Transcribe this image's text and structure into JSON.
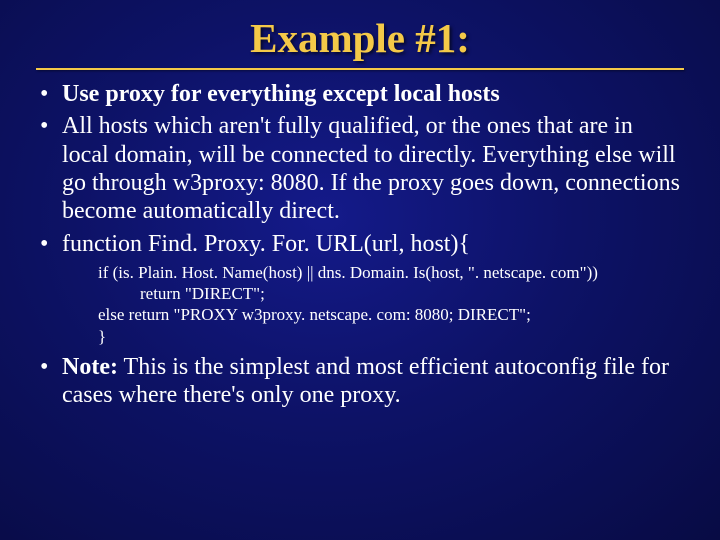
{
  "title": "Example #1:",
  "bullets": {
    "b1": "Use proxy for everything except local hosts",
    "b2": "All hosts which aren't fully qualified, or the ones that are in local domain, will be connected to directly. Everything else will go through w3proxy: 8080. If the proxy goes down, connections become automatically direct.",
    "b3": "function Find. Proxy. For. URL(url, host){",
    "b4_note_label": "Note:",
    "b4_rest": " This is the simplest and most efficient autoconfig file for cases where there's only one proxy."
  },
  "code": {
    "l1": "if (is. Plain. Host. Name(host) ||  dns. Domain. Is(host, \". netscape. com\"))",
    "l2": "return \"DIRECT\";",
    "l3": "else  return \"PROXY w3proxy. netscape. com: 8080; DIRECT\";",
    "l4": "}"
  }
}
